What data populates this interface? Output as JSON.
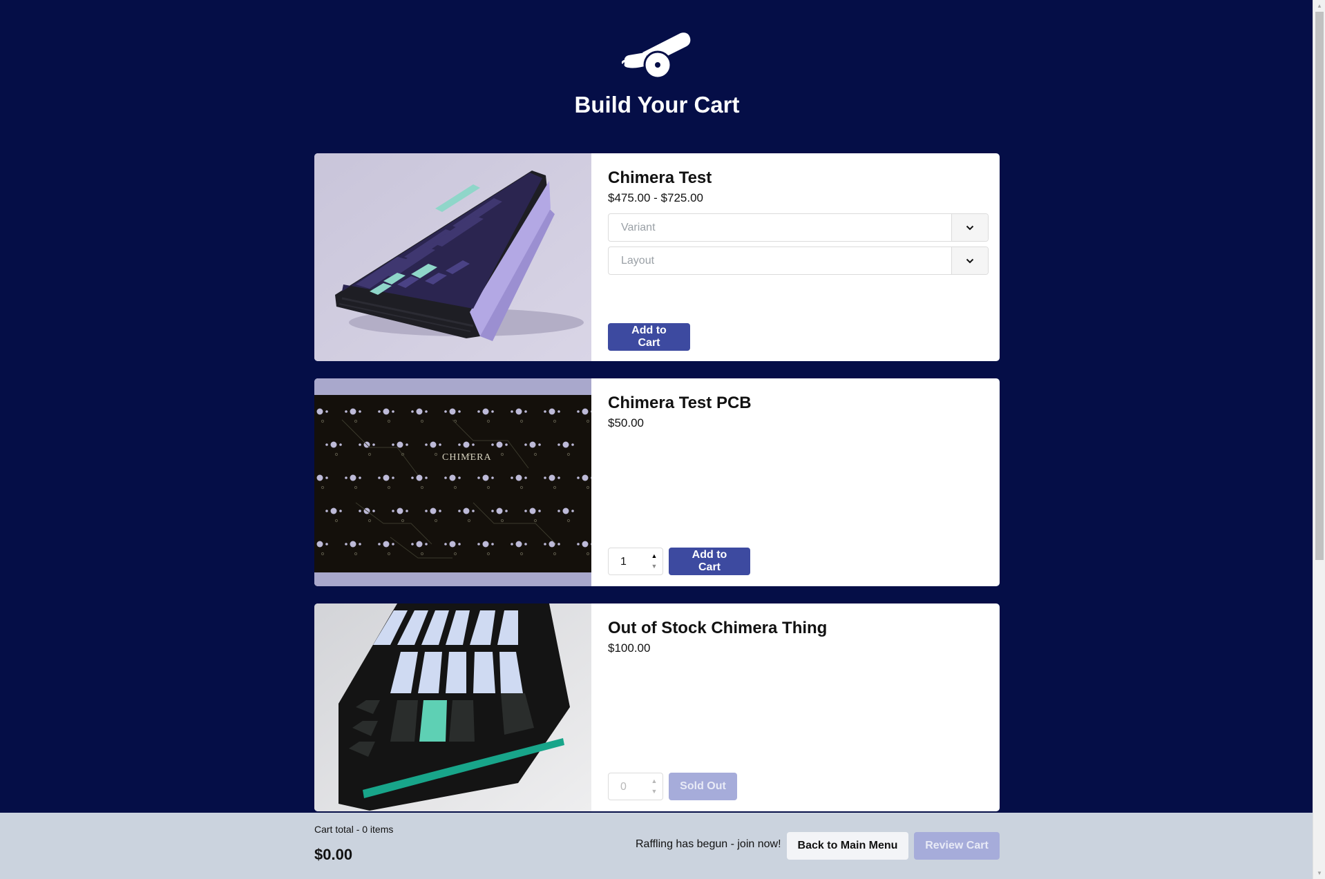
{
  "header": {
    "title": "Build Your Cart",
    "logo_icon": "cannon-icon"
  },
  "products": [
    {
      "name": "Chimera Test",
      "price": "$475.00 - $725.00",
      "image": "keyboard-purple-image",
      "selects": [
        {
          "placeholder": "Variant"
        },
        {
          "placeholder": "Layout"
        }
      ],
      "add_label": "Add to Cart"
    },
    {
      "name": "Chimera Test PCB",
      "price": "$50.00",
      "image": "pcb-image",
      "pcb_label": "CHIMERA",
      "quantity": "1",
      "add_label": "Add to Cart"
    },
    {
      "name": "Out of Stock Chimera Thing",
      "price": "$100.00",
      "image": "keyboard-black-image",
      "quantity": "0",
      "add_label": "Sold Out"
    }
  ],
  "footer": {
    "cart_label": "Cart total - 0 items",
    "cart_total": "$0.00",
    "raffle_text": "Raffling has begun - join now!",
    "back_label": "Back to Main Menu",
    "review_label": "Review Cart"
  },
  "colors": {
    "background": "#050e47",
    "primary": "#3d4aa0",
    "disabled": "#a6acda",
    "footer": "#cbd3de"
  }
}
